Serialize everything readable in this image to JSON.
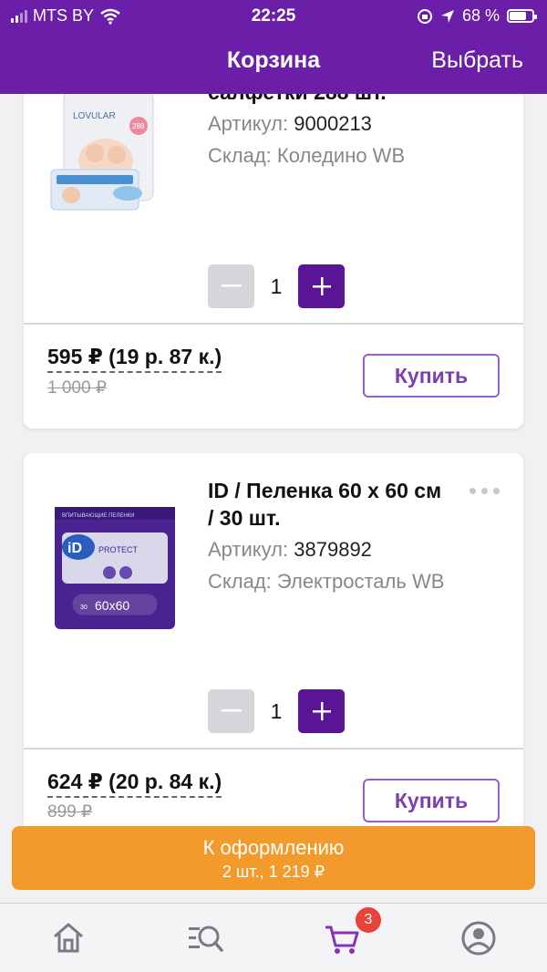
{
  "status_bar": {
    "carrier": "MTS BY",
    "time": "22:25",
    "battery": "68 %"
  },
  "header": {
    "title": "Корзина",
    "action": "Выбрать"
  },
  "items": [
    {
      "name": "салфетки 288 шт.",
      "article_label": "Артикул:",
      "article": "9000213",
      "warehouse_label": "Склад:",
      "warehouse": "Коледино WB",
      "quantity": "1",
      "price": "595 ₽ (19 р. 87 к.)",
      "old_price": "1 000 ₽",
      "buy_label": "Купить",
      "image_brand": "LOVULAR",
      "image_count": "288"
    },
    {
      "name": "ID / Пеленка 60 х 60 см / 30 шт.",
      "article_label": "Артикул:",
      "article": "3879892",
      "warehouse_label": "Склад:",
      "warehouse": "Электросталь WB",
      "quantity": "1",
      "price": "624 ₽ (20 р. 84 к.)",
      "old_price": "899 ₽",
      "buy_label": "Купить",
      "image_brand": "iD",
      "image_line": "PROTECT",
      "image_header": "ВПИТЫВАЮЩИЕ ПЕЛЕНКИ",
      "image_size": "60x60",
      "image_count": "30"
    }
  ],
  "checkout": {
    "label": "К оформлению",
    "summary": "2 шт., 1 219 ₽"
  },
  "tabbar": {
    "cart_badge": "3"
  },
  "colors": {
    "brand": "#6b1fa8",
    "checkout": "#f39a2c",
    "badge": "#e8423a"
  }
}
